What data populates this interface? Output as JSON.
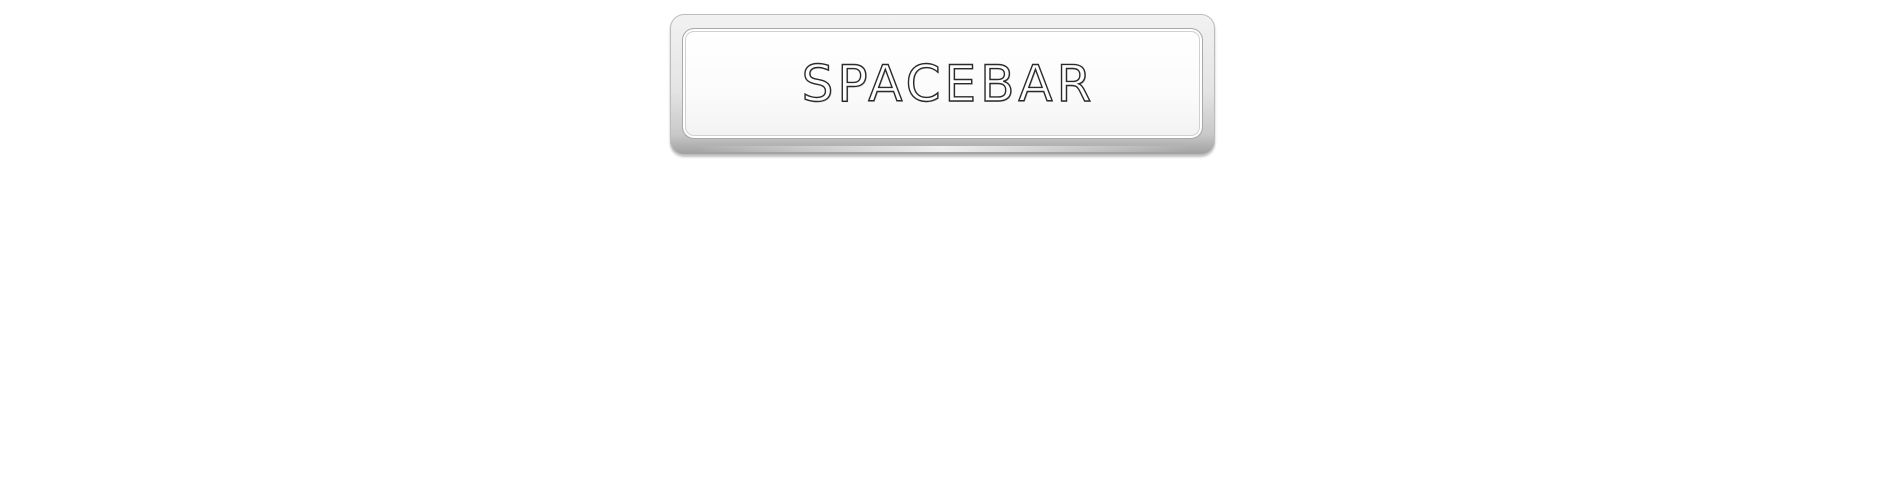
{
  "key": {
    "label": "SPACEBAR"
  }
}
